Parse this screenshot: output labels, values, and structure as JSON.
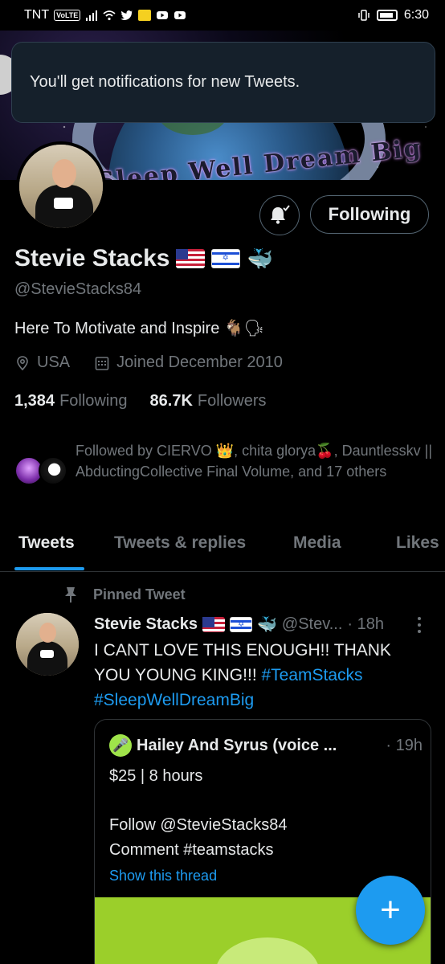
{
  "status_bar": {
    "carrier": "TNT",
    "volte": "VoLTE",
    "time": "6:30"
  },
  "banner": {
    "text": "Sleep Well Dream Big"
  },
  "toast": {
    "message": "You'll get notifications for new Tweets."
  },
  "profile": {
    "name": "Stevie Stacks",
    "name_emoji": [
      "us-flag-icon",
      "israel-flag-icon",
      "whale-icon"
    ],
    "handle": "@StevieStacks84",
    "bio": "Here To Motivate and Inspire 🐐🗣",
    "location": "USA",
    "joined": "Joined December 2010",
    "following_count": "1,384",
    "following_label": "Following",
    "followers_count": "86.7K",
    "followers_label": "Followers",
    "follow_button": "Following",
    "followed_by": "Followed by CIERVO 👑, chita glorya🍒, Dauntlesskv || AbductingCollective Final Volume, and 17 others"
  },
  "tabs": [
    {
      "label": "Tweets",
      "active": true
    },
    {
      "label": "Tweets & replies",
      "active": false
    },
    {
      "label": "Media",
      "active": false
    },
    {
      "label": "Likes",
      "active": false
    }
  ],
  "pinned_tweet": {
    "pinned_label": "Pinned Tweet",
    "author_name": "Stevie Stacks",
    "author_handle": "@Stev...",
    "time": "· 18h",
    "text_plain": "I CANT LOVE THIS ENOUGH!! THANK YOU YOUNG KING!!! ",
    "hashtag1": "#TeamStacks",
    "hashtag2": "#SleepWellDreamBig",
    "quoted": {
      "author_name": "Hailey And Syrus (voice ...",
      "time": "· 19h",
      "line1": "$25 | 8 hours",
      "line2": "Follow @StevieStacks84",
      "line3": "Comment #teamstacks",
      "show_thread": "Show this thread"
    }
  },
  "colors": {
    "accent": "#1d9bf0",
    "background": "#000000",
    "muted_text": "#71767b",
    "primary_text": "#e7e9ea",
    "toast_bg": "#15202b"
  }
}
